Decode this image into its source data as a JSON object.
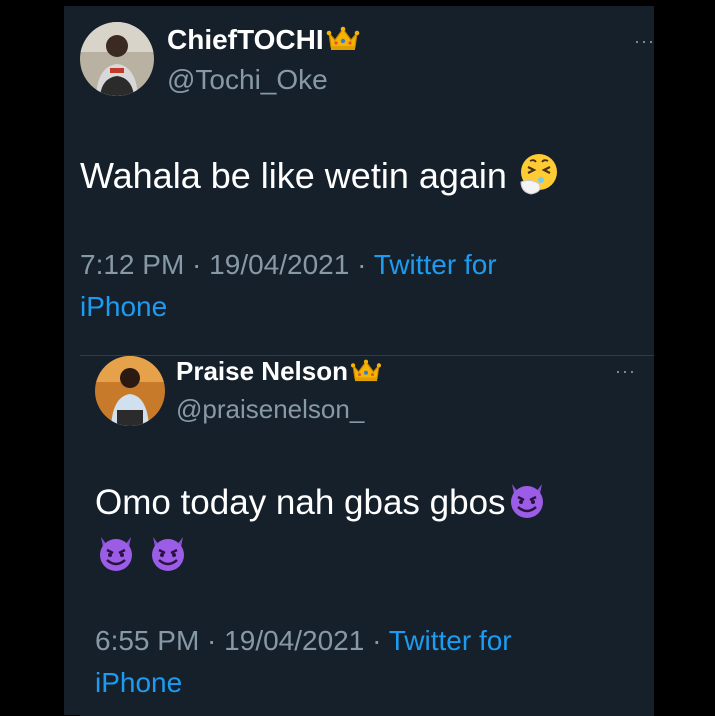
{
  "tweets": [
    {
      "name": "ChiefTOCHI",
      "handle": "@Tochi_Oke",
      "more_label": "···",
      "text": "Wahala be like wetin again",
      "time": "7:12 PM",
      "sep1": " · ",
      "date": "19/04/2021",
      "sep2": " · ",
      "source_line1": "Twitter for",
      "source_line2": "iPhone",
      "icons": [
        "crown-icon",
        "sneezing-face-icon"
      ]
    },
    {
      "name": "Praise Nelson",
      "handle": "@praisenelson_",
      "more_label": "···",
      "text": "Omo today nah gbas gbos",
      "time": "6:55 PM",
      "sep1": " · ",
      "date": "19/04/2021",
      "sep2": " · ",
      "source_line1": "Twitter for",
      "source_line2": "iPhone",
      "icons": [
        "crown-icon",
        "smiling-devil-icon",
        "smiling-devil-icon",
        "smiling-devil-icon"
      ]
    }
  ],
  "colors": {
    "background": "#15202b",
    "primary_text": "#ffffff",
    "secondary_text": "#8899a6",
    "link": "#1d9bf0"
  }
}
